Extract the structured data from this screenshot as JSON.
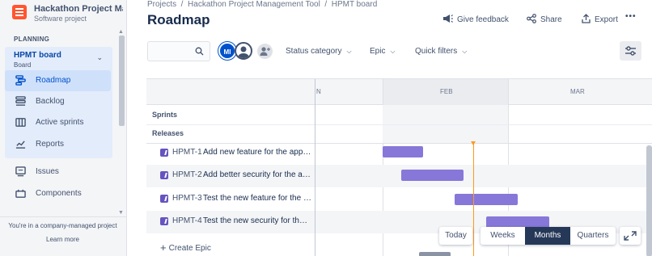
{
  "colors": {
    "accent": "#0052cc",
    "epic": "#6554c0",
    "bar": "#8777d9",
    "today": "#ff991f"
  },
  "sidebar": {
    "project_name": "Hackathon Project Ma...",
    "project_type": "Software project",
    "section_label": "PLANNING",
    "board": {
      "title": "HPMT board",
      "subtitle": "Board"
    },
    "items": [
      {
        "label": "Roadmap",
        "icon": "roadmap-icon",
        "active": true
      },
      {
        "label": "Backlog",
        "icon": "backlog-icon"
      },
      {
        "label": "Active sprints",
        "icon": "board-columns-icon"
      },
      {
        "label": "Reports",
        "icon": "chart-line-icon"
      },
      {
        "label": "Issues",
        "icon": "issues-icon"
      },
      {
        "label": "Components",
        "icon": "components-icon"
      }
    ],
    "footer_text": "You're in a company-managed project",
    "footer_link": "Learn more"
  },
  "header": {
    "breadcrumb": [
      "Projects",
      "Hackathon Project Management Tool",
      "HPMT board"
    ],
    "title": "Roadmap",
    "feedback_label": "Give feedback",
    "share_label": "Share",
    "export_label": "Export",
    "more_label": "•••"
  },
  "filters": {
    "avatar_initials": "MI",
    "status_category_label": "Status category",
    "epic_label": "Epic",
    "quick_filters_label": "Quick filters"
  },
  "timeline": {
    "months": [
      "N",
      "FEB",
      "MAR"
    ],
    "sprints_label": "Sprints",
    "releases_label": "Releases",
    "epics": [
      {
        "key": "HPMT-1",
        "title": "Add new feature for the applic..."
      },
      {
        "key": "HPMT-2",
        "title": "Add better security for the app..."
      },
      {
        "key": "HPMT-3",
        "title": "Test the new feature for the ap..."
      },
      {
        "key": "HPMT-4",
        "title": "Test the new security for the ap..."
      }
    ],
    "create_epic_label": "Create Epic"
  },
  "zoom": {
    "today_label": "Today",
    "weeks_label": "Weeks",
    "months_label": "Months",
    "quarters_label": "Quarters",
    "selected": "Months"
  }
}
